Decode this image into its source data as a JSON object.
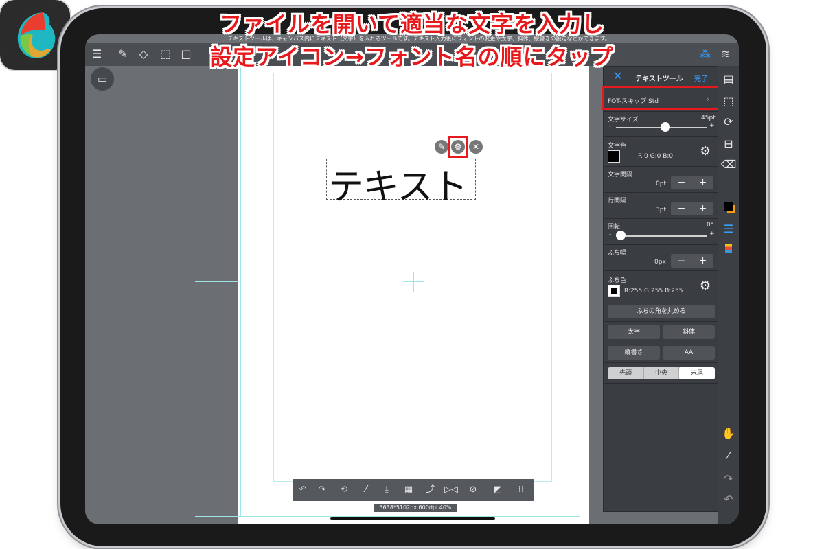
{
  "captions": {
    "line1": "ファイルを開いて適当な文字を入力し",
    "line2": "設定アイコン→フォント名の順にタップ"
  },
  "hint_text": "テキストツールは、キャンバス内にテキスト（文字）を入れるツールです。テキスト入力後にフォントの変更や太字、斜体、縦書きの設定などができます。",
  "canvas": {
    "text": "テキスト"
  },
  "status_bar": "3638*5102px 600dpi 40%",
  "panel": {
    "title": "テキストツール",
    "done": "完了",
    "font_name": "FOT-スキップ Std",
    "font_size": {
      "label": "文字サイズ",
      "value": "45pt",
      "level": 0.68
    },
    "text_color": {
      "label": "文字色",
      "value": "R:0 G:0 B:0",
      "swatch": "#000000"
    },
    "letter_spacing": {
      "label": "文字間隔",
      "value": "0pt"
    },
    "line_spacing": {
      "label": "行間隔",
      "value": "3pt"
    },
    "rotation": {
      "label": "回転",
      "value": "0°",
      "level": 0.0
    },
    "outline_width": {
      "label": "ふち幅",
      "value": "0px"
    },
    "outline_color": {
      "label": "ふち色",
      "value": "R:255 G:255 B:255",
      "swatch": "#ffffff"
    },
    "round_corners": "ふちの角を丸める",
    "bold": "太字",
    "italic": "斜体",
    "vertical": "縦書き",
    "aa": "AA",
    "align": [
      "先頭",
      "中央",
      "末尾"
    ],
    "align_selected": 2
  },
  "colors": {
    "caption_red": "#e8191c",
    "accent_blue": "#3aa0ff",
    "panel_bg": "#3a3d42"
  }
}
